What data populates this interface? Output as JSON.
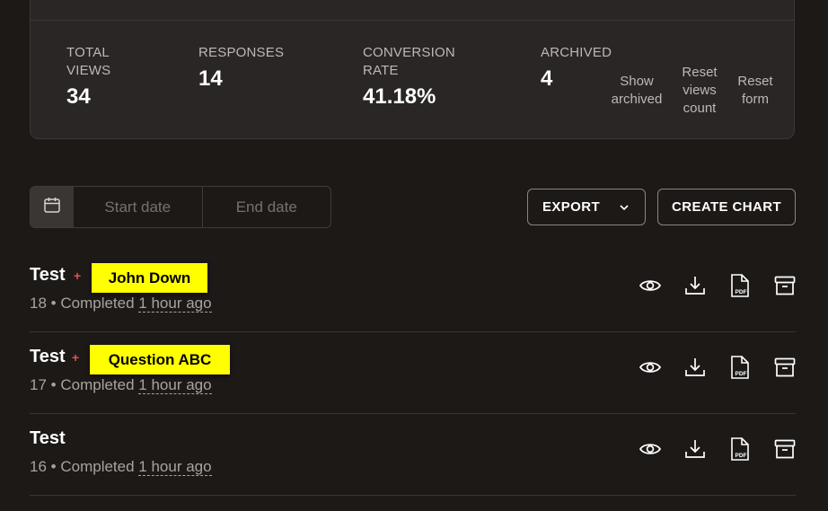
{
  "stats": [
    {
      "label": "TOTAL VIEWS",
      "value": "34"
    },
    {
      "label": "RESPONSES",
      "value": "14"
    },
    {
      "label": "CONVERSION RATE",
      "value": "41.18%"
    },
    {
      "label": "ARCHIVED",
      "value": "4"
    }
  ],
  "stat_actions": {
    "show_archived": "Show archived",
    "reset_views_count": "Reset views count",
    "reset_form": "Reset form"
  },
  "date_filter": {
    "start_placeholder": "Start date",
    "end_placeholder": "End date"
  },
  "toolbar": {
    "export_label": "EXPORT",
    "create_chart_label": "CREATE CHART"
  },
  "responses": [
    {
      "title": "Test",
      "tag": "John Down",
      "number": "18",
      "status": "Completed",
      "ago": "1 hour ago"
    },
    {
      "title": "Test",
      "tag": "Question ABC",
      "number": "17",
      "status": "Completed",
      "ago": "1 hour ago"
    },
    {
      "title": "Test",
      "tag": "",
      "number": "16",
      "status": "Completed",
      "ago": "1 hour ago"
    }
  ],
  "plus_sign": "+",
  "separator": "•",
  "pdf_icon_text": "PDF",
  "colors": {
    "background": "#1d1917",
    "card": "#292625",
    "tag_highlight": "#ffff00",
    "plus_red": "#e5504c"
  }
}
